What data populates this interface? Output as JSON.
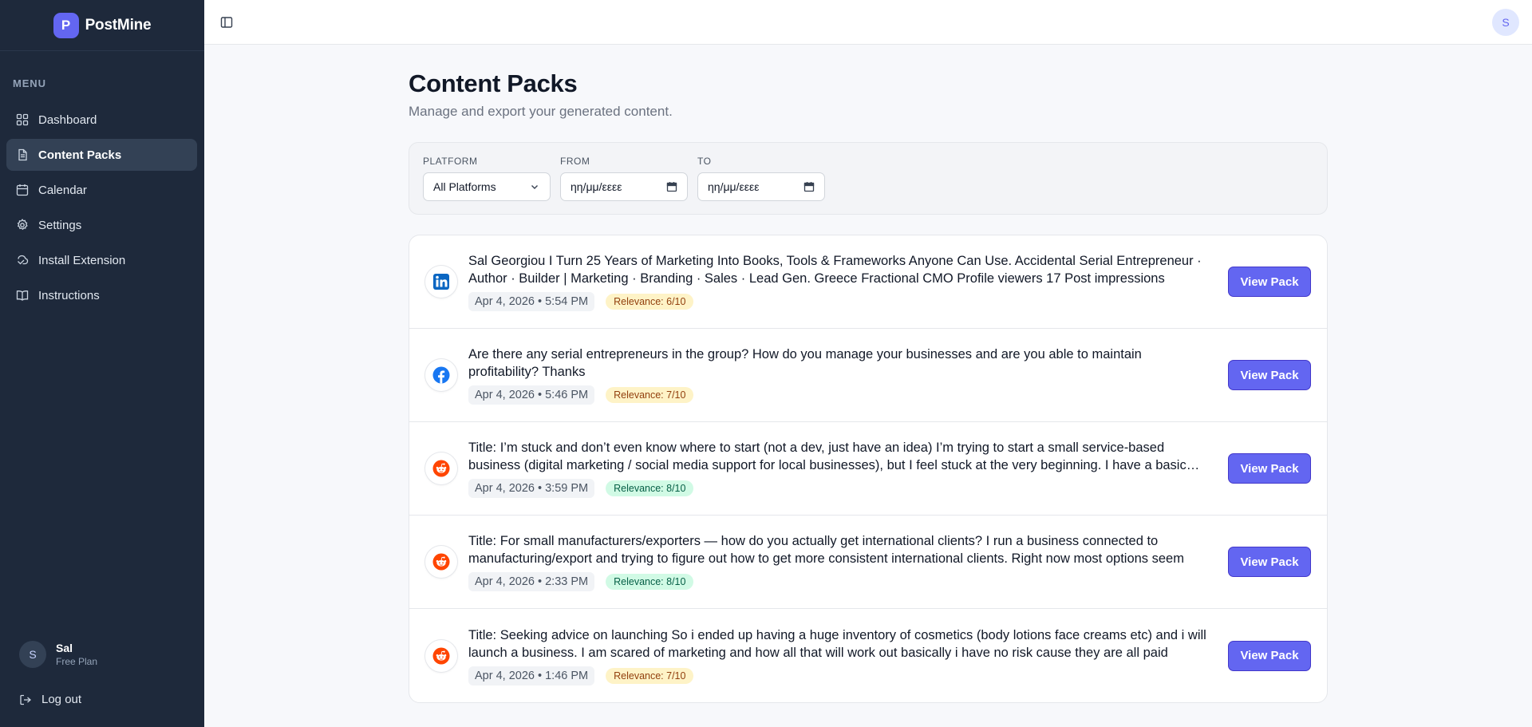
{
  "app": {
    "logo_letter": "P",
    "name": "PostMine"
  },
  "sidebar": {
    "menu_label": "MENU",
    "items": [
      {
        "label": "Dashboard",
        "icon": "dashboard-icon"
      },
      {
        "label": "Content Packs",
        "icon": "document-icon",
        "active": true
      },
      {
        "label": "Calendar",
        "icon": "calendar-icon"
      },
      {
        "label": "Settings",
        "icon": "gear-icon"
      },
      {
        "label": "Install Extension",
        "icon": "puzzle-icon"
      },
      {
        "label": "Instructions",
        "icon": "book-icon"
      }
    ],
    "user": {
      "initial": "S",
      "name": "Sal",
      "plan": "Free Plan"
    },
    "logout_label": "Log out"
  },
  "topbar": {
    "avatar_initial": "S"
  },
  "page": {
    "title": "Content Packs",
    "subtitle": "Manage and export your generated content."
  },
  "filters": {
    "platform": {
      "label": "PLATFORM",
      "value": "All Platforms"
    },
    "from": {
      "label": "FROM",
      "placeholder": "ηη/μμ/εεεε"
    },
    "to": {
      "label": "TO",
      "placeholder": "ηη/μμ/εεεε"
    }
  },
  "packs": [
    {
      "platform": "linkedin",
      "text": "Sal Georgiou I Turn 25 Years of Marketing Into Books, Tools & Frameworks Anyone Can Use. Accidental Serial Entrepreneur · Author · Builder | Marketing · Branding · Sales · Lead Gen. Greece Fractional CMO Profile viewers 17 Post impressions",
      "date": "Apr 4, 2026 • 5:54 PM",
      "relevance": "Relevance: 6/10",
      "relevance_color": "amber",
      "button": "View Pack"
    },
    {
      "platform": "facebook",
      "text": "Are there any serial entrepreneurs in the group? How do you manage your businesses and are you able to maintain profitability? Thanks",
      "date": "Apr 4, 2026 • 5:46 PM",
      "relevance": "Relevance: 7/10",
      "relevance_color": "amber",
      "button": "View Pack"
    },
    {
      "platform": "reddit",
      "text": "Title: I’m stuck and don’t even know where to start (not a dev, just have an idea) I’m trying to start a small service-based business (digital marketing / social media support for local businesses), but I feel stuck at the very beginning. I have a basic idea",
      "date": "Apr 4, 2026 • 3:59 PM",
      "relevance": "Relevance: 8/10",
      "relevance_color": "green",
      "button": "View Pack"
    },
    {
      "platform": "reddit",
      "text": "Title: For small manufacturers/exporters — how do you actually get international clients? I run a business connected to manufacturing/export and trying to figure out how to get more consistent international clients. Right now most options seem",
      "date": "Apr 4, 2026 • 2:33 PM",
      "relevance": "Relevance: 8/10",
      "relevance_color": "green",
      "button": "View Pack"
    },
    {
      "platform": "reddit",
      "text": "Title: Seeking advice on launching So i ended up having a huge inventory of cosmetics (body lotions face creams etc) and i will launch a business. I am scared of marketing and how all that will work out basically i have no risk cause they are all paid",
      "date": "Apr 4, 2026 • 1:46 PM",
      "relevance": "Relevance: 7/10",
      "relevance_color": "amber",
      "button": "View Pack"
    }
  ],
  "colors": {
    "sidebar_bg": "#1e293b",
    "accent": "#6366f1",
    "linkedin": "#0a66c2",
    "facebook": "#1877f2",
    "reddit": "#ff4500"
  }
}
